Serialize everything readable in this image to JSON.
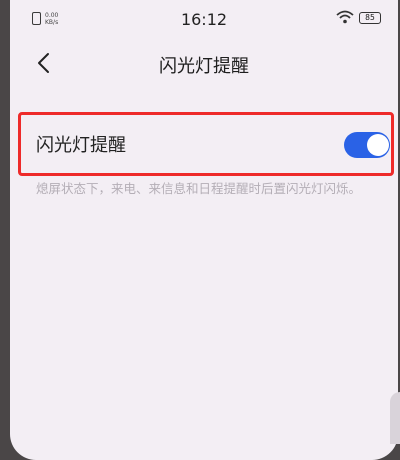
{
  "status_bar": {
    "time": "16:12",
    "net_speed_value": "0.00",
    "net_speed_unit": "KB/s",
    "battery": "85",
    "wifi_icon": "wifi-icon",
    "sim_icon": "sim-icon"
  },
  "header": {
    "title": "闪光灯提醒",
    "back_icon": "chevron-left-icon"
  },
  "setting": {
    "label": "闪光灯提醒",
    "toggle_on": true,
    "toggle_color": "#2a62e6",
    "highlight_color": "#ee2a2a"
  },
  "description": "熄屏状态下，来电、来信息和日程提醒时后置闪光灯闪烁。"
}
